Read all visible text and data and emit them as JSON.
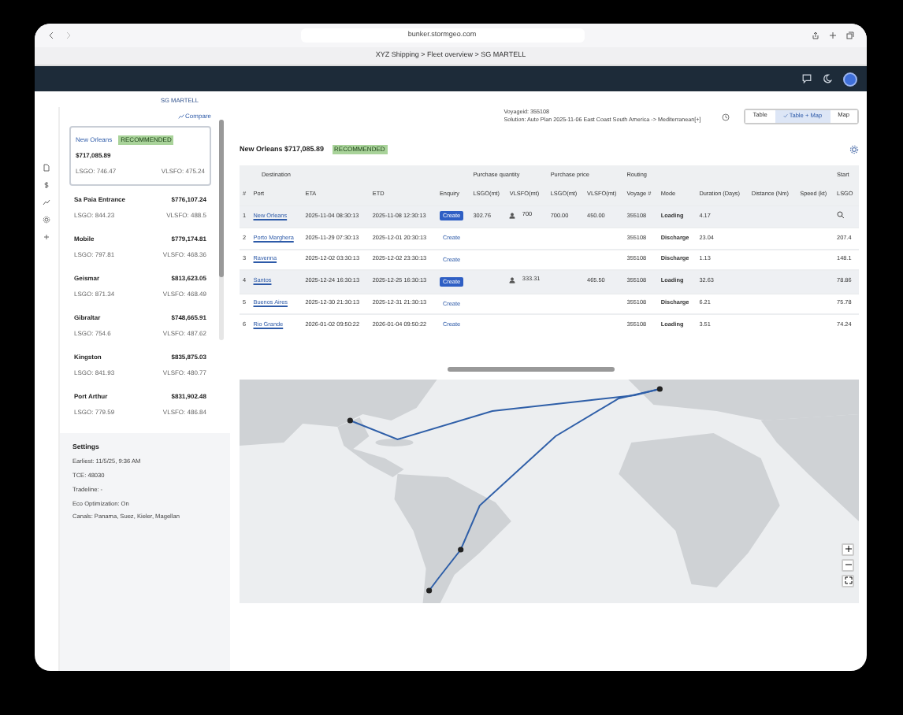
{
  "browser": {
    "url": "bunker.stormgeo.com",
    "breadcrumb": "XYZ Shipping > Fleet overview > SG MARTELL"
  },
  "page_title": "SG MARTELL",
  "voyage": {
    "id": "Voyageid: 355108",
    "solution": "Solution: Auto Plan 2025-11-06 East Coast South America -> Mediterranean[+]"
  },
  "views": [
    {
      "label": "Table",
      "selected": false
    },
    {
      "label": "Table + Map",
      "selected": true
    },
    {
      "label": "Map",
      "selected": false
    }
  ],
  "compare": "Compare",
  "ports": [
    {
      "name": "New Orleans",
      "badge": "RECOMMENDED",
      "total": "$717,085.89",
      "lsgo": "LSGO: 746.47",
      "vlsfo": "VLSFO: 475.24",
      "selected": true
    },
    {
      "name": "Sa Paia Entrance",
      "total": "$776,107.24",
      "lsgo": "LSGO: 844.23",
      "vlsfo": "VLSFO: 488.5",
      "selected": false
    },
    {
      "name": "Mobile",
      "total": "$779,174.81",
      "lsgo": "LSGO: 797.81",
      "vlsfo": "VLSFO: 468.36",
      "selected": false
    },
    {
      "name": "Geismar",
      "total": "$813,623.05",
      "lsgo": "LSGO: 871.34",
      "vlsfo": "VLSFO: 468.49",
      "selected": false
    },
    {
      "name": "Gibraltar",
      "total": "$748,665.91",
      "lsgo": "LSGO: 754.6",
      "vlsfo": "VLSFO: 487.62",
      "selected": false
    },
    {
      "name": "Kingston",
      "total": "$835,875.03",
      "lsgo": "LSGO: 841.93",
      "vlsfo": "VLSFO: 480.77",
      "selected": false
    },
    {
      "name": "Port Arthur",
      "total": "$831,902.48",
      "lsgo": "LSGO: 779.59",
      "vlsfo": "VLSFO: 486.84",
      "selected": false
    }
  ],
  "settings": {
    "title": "Settings",
    "lines": [
      "Earliest: 11/5/25, 9:36 AM",
      "TCE: 48030",
      "Tradeline: -",
      "Eco Optimization: On",
      "Canals: Panama, Suez, Kieler, Magellan"
    ]
  },
  "summary": {
    "title": "New Orleans $717,085.89",
    "badge": "RECOMMENDED"
  },
  "table": {
    "groups": [
      {
        "label": "Destination",
        "columns": [
          "#",
          "Port",
          "ETA",
          "ETD",
          "Enquiry"
        ]
      },
      {
        "label": "Purchase quantity",
        "columns": [
          "LSGO(mt)",
          "VLSFO(mt)"
        ]
      },
      {
        "label": "Purchase price",
        "columns": [
          "LSGO(mt)",
          "VLSFO(mt)"
        ]
      },
      {
        "label": "Routing",
        "columns": [
          "Voyage #",
          "Mode",
          "Duration (Days)",
          "Distance (Nm)",
          "Speed (kt)"
        ]
      },
      {
        "label": "Start",
        "columns": [
          "LSGO"
        ]
      }
    ],
    "rows": [
      {
        "selected": true,
        "cells": [
          "1",
          {
            "text": "New Orleans",
            "kind": "link"
          },
          "2025-11-04 08:30:13",
          "2025-11-08 12:30:13",
          {
            "text": "Create",
            "kind": "filled"
          },
          "302.76",
          {
            "text": "700",
            "kind": "person"
          },
          "700.00",
          "450.00",
          "355108",
          "Loading",
          "4.17",
          "",
          "",
          {
            "kind": "search"
          }
        ]
      },
      {
        "selected": false,
        "cells": [
          "2",
          {
            "text": "Porto Marghera",
            "kind": "link"
          },
          "2025-11-29 07:30:13",
          "2025-12-01 20:30:13",
          {
            "text": "Create",
            "kind": "button-link"
          },
          "",
          "",
          "",
          "",
          "355108",
          "Discharge",
          "23.04",
          "",
          "",
          "207.4"
        ]
      },
      {
        "selected": false,
        "cells": [
          "3",
          {
            "text": "Ravenna",
            "kind": "link"
          },
          "2025-12-02 03:30:13",
          "2025-12-02 23:30:13",
          {
            "text": "Create",
            "kind": "button-link"
          },
          "",
          "",
          "",
          "",
          "355108",
          "Discharge",
          "1.13",
          "",
          "",
          "148.1"
        ]
      },
      {
        "selected": true,
        "cells": [
          "4",
          {
            "text": "Santos",
            "kind": "link"
          },
          "2025-12-24 16:30:13",
          "2025-12-25 16:30:13",
          {
            "text": "Create",
            "kind": "filled"
          },
          "",
          {
            "text": "333.31",
            "kind": "person"
          },
          "",
          "465.50",
          "355108",
          "Loading",
          "32.63",
          "",
          "",
          "78.86"
        ]
      },
      {
        "selected": false,
        "cells": [
          "5",
          {
            "text": "Buenos Aires",
            "kind": "link"
          },
          "2025-12-30 21:30:13",
          "2025-12-31 21:30:13",
          {
            "text": "Create",
            "kind": "button-link"
          },
          "",
          "",
          "",
          "",
          "355108",
          "Discharge",
          "6.21",
          "",
          "",
          "75.78"
        ]
      },
      {
        "selected": false,
        "cells": [
          "6",
          {
            "text": "Rio Grande",
            "kind": "link"
          },
          "2026-01-02 09:50:22",
          "2026-01-04 09:50:22",
          {
            "text": "Create",
            "kind": "button-link"
          },
          "",
          "",
          "",
          "",
          "355108",
          "Loading",
          "3.51",
          "",
          "",
          "74.24"
        ]
      }
    ]
  }
}
